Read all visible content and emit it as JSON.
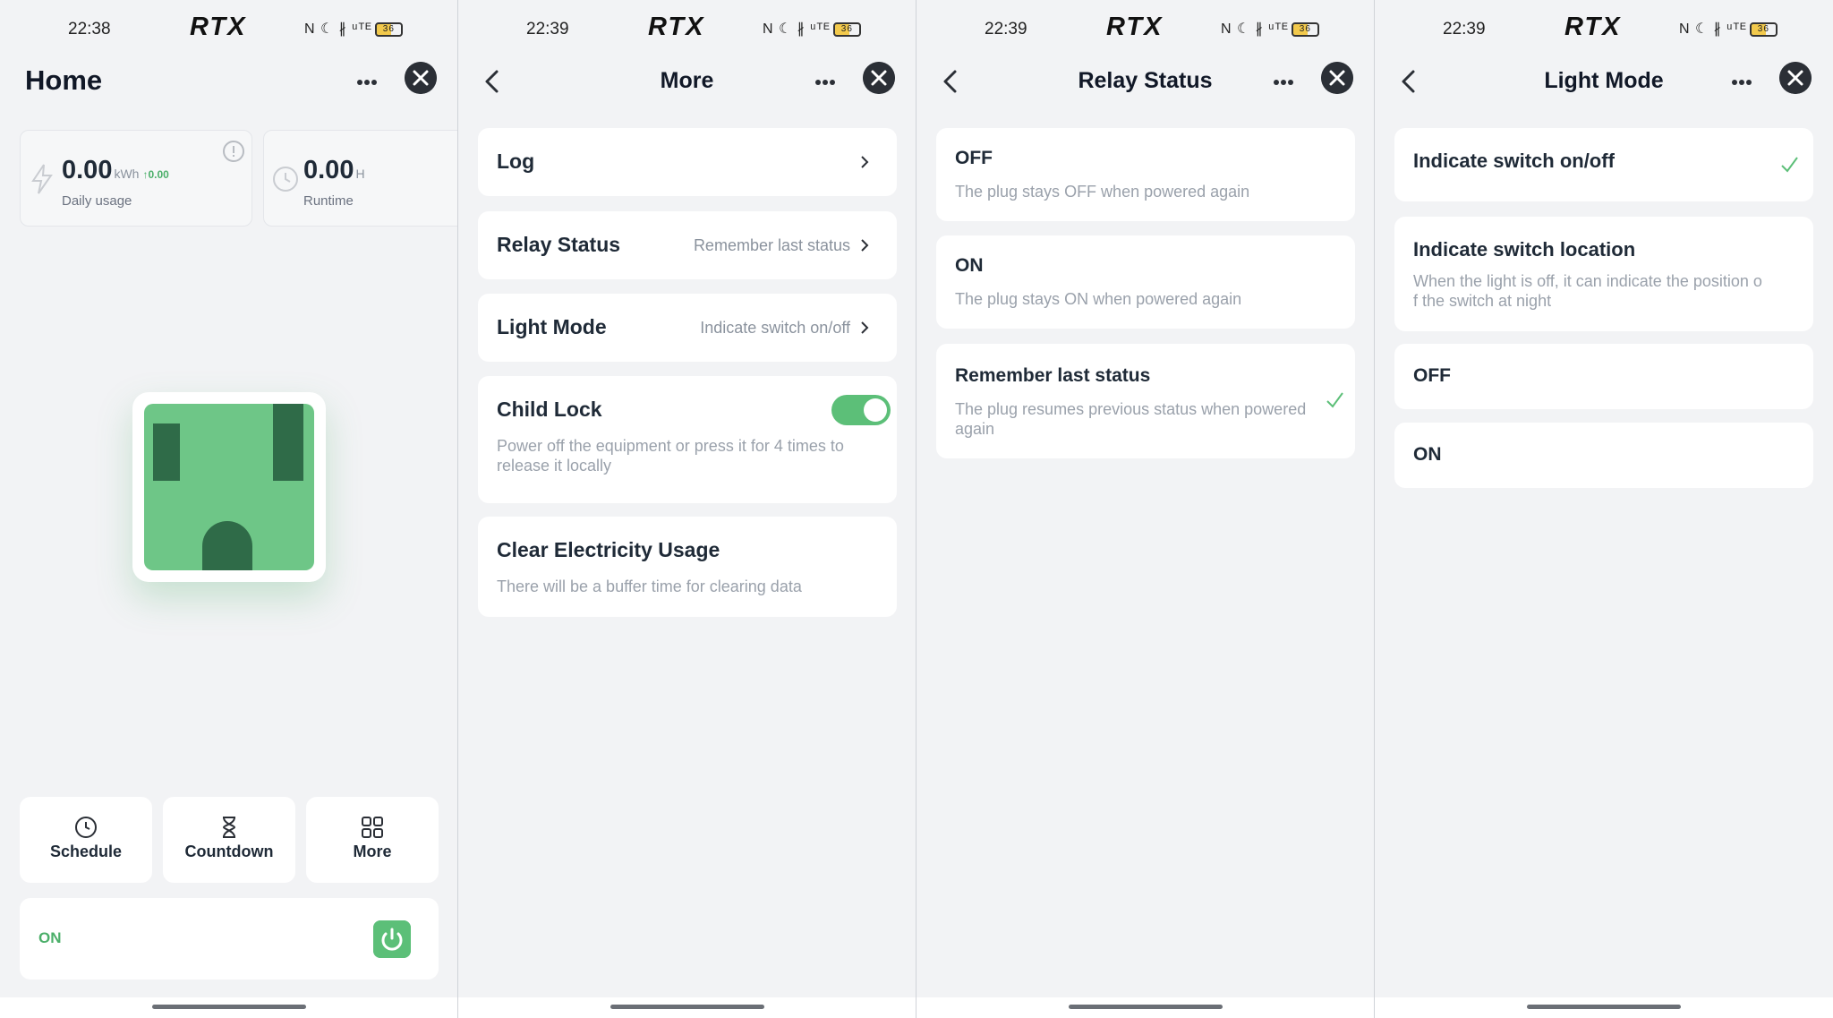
{
  "status_bar": {
    "brand": "RTX",
    "panels_time": [
      "22:38",
      "22:39",
      "22:39",
      "22:39"
    ],
    "icons_text": "N ☾ ∦ ᵘᵀᴱ",
    "battery": "36"
  },
  "home": {
    "title": "Home",
    "daily_usage": {
      "value": "0.00",
      "unit": "kWh",
      "delta": "0.00",
      "label": "Daily usage"
    },
    "runtime": {
      "value": "0.00",
      "unit": "H",
      "label": "Runtime"
    },
    "actions": [
      {
        "label": "Schedule",
        "icon": "clock-icon"
      },
      {
        "label": "Countdown",
        "icon": "hourglass-icon"
      },
      {
        "label": "More",
        "icon": "grid-icon"
      }
    ],
    "power_state": "ON"
  },
  "more": {
    "title": "More",
    "items": [
      {
        "title": "Log",
        "value": ""
      },
      {
        "title": "Relay Status",
        "value": "Remember last status"
      },
      {
        "title": "Light Mode",
        "value": "Indicate switch on/off"
      }
    ],
    "child_lock": {
      "title": "Child Lock",
      "desc_line1": "Power off the equipment or press it for 4 times to",
      "desc_line2": "release it locally",
      "enabled": true
    },
    "clear_usage": {
      "title": "Clear Electricity Usage",
      "desc": "There will be a buffer time for clearing data"
    }
  },
  "relay_status": {
    "title": "Relay Status",
    "options": [
      {
        "title": "OFF",
        "desc": "The plug stays OFF when powered again",
        "selected": false
      },
      {
        "title": "ON",
        "desc": "The plug stays ON when powered again",
        "selected": false
      },
      {
        "title": "Remember last status",
        "desc_line1": "The plug resumes previous status when powered",
        "desc_line2": "again",
        "selected": true
      }
    ]
  },
  "light_mode": {
    "title": "Light Mode",
    "options": [
      {
        "title": "Indicate switch on/off",
        "selected": true
      },
      {
        "title": "Indicate switch location",
        "desc_line1": "When the light is off, it can indicate the position o",
        "desc_line2": "f the switch at night",
        "selected": false
      },
      {
        "title": "OFF",
        "selected": false
      },
      {
        "title": "ON",
        "selected": false
      }
    ]
  },
  "colors": {
    "accent_green": "#5cbf78",
    "background": "#f2f3f5",
    "close_button": "#2b2f36"
  }
}
